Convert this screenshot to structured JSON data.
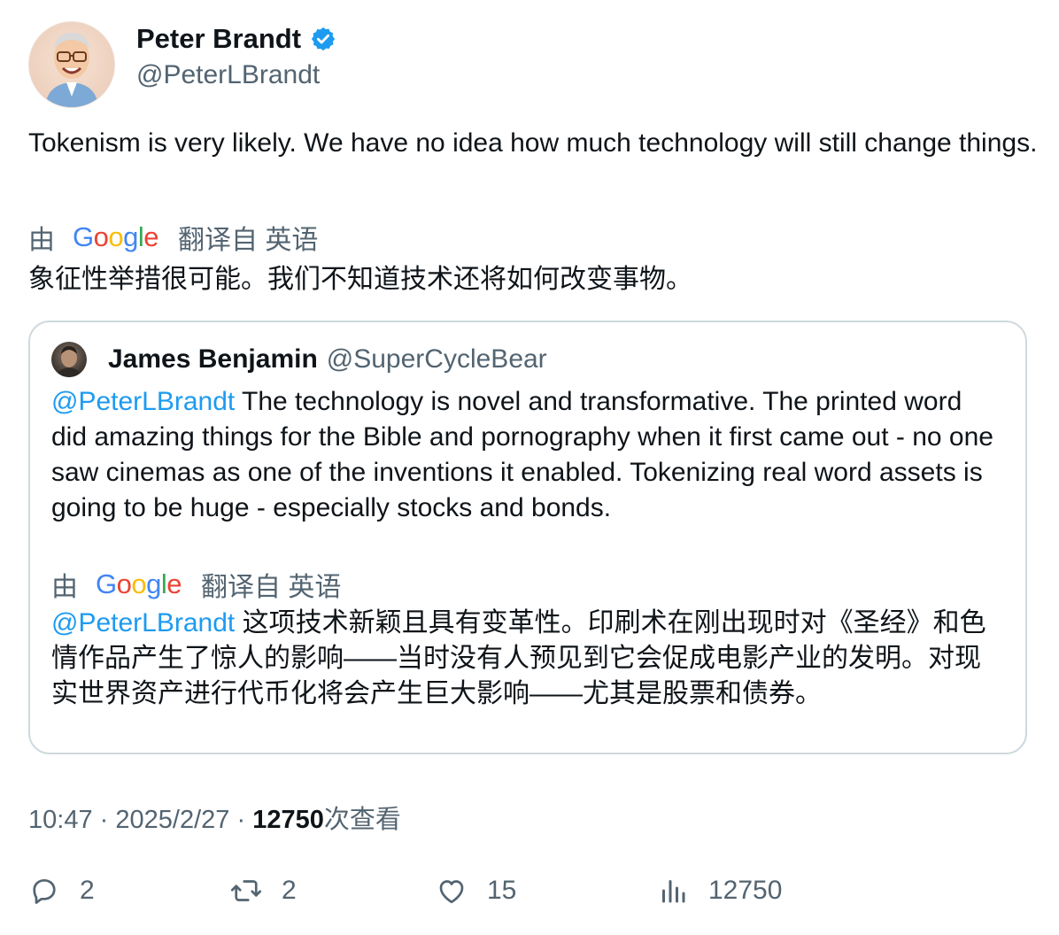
{
  "author": {
    "name": "Peter Brandt",
    "handle": "@PeterLBrandt",
    "verified_icon": "verified-badge-icon"
  },
  "tweet": {
    "text": "Tokenism is very likely. We have no idea how much technology will still change things.",
    "translation_prefix": "由",
    "translation_provider": "Google",
    "translation_suffix": "翻译自 英语",
    "translated_text": "象征性举措很可能。我们不知道技术还将如何改变事物。"
  },
  "quote": {
    "name": "James Benjamin",
    "handle": "@SuperCycleBear",
    "mention": "@PeterLBrandt",
    "text": " The technology is novel and transformative. The printed word did amazing things for the Bible and pornography when it first came out - no one saw cinemas as one of the inventions it enabled. Tokenizing real word assets is going to be huge - especially stocks and bonds.",
    "translation_prefix": "由",
    "translation_provider": "Google",
    "translation_suffix": "翻译自 英语",
    "translated_mention": "@PeterLBrandt",
    "translated_text": " 这项技术新颖且具有变革性。印刷术在刚出现时对《圣经》和色情作品产生了惊人的影响——当时没有人预见到它会促成电影产业的发明。对现实世界资产进行代币化将会产生巨大影响——尤其是股票和债券。"
  },
  "meta": {
    "time": "10:47",
    "separator": "·",
    "date": "2025/2/27",
    "views": "12750",
    "views_suffix": "次查看"
  },
  "actions": {
    "reply_count": "2",
    "retweet_count": "2",
    "like_count": "15",
    "views_count": "12750"
  },
  "colors": {
    "link": "#1d9bf0",
    "secondary_text": "#536471",
    "border": "#cfd9de",
    "verified": "#1d9bf0"
  }
}
